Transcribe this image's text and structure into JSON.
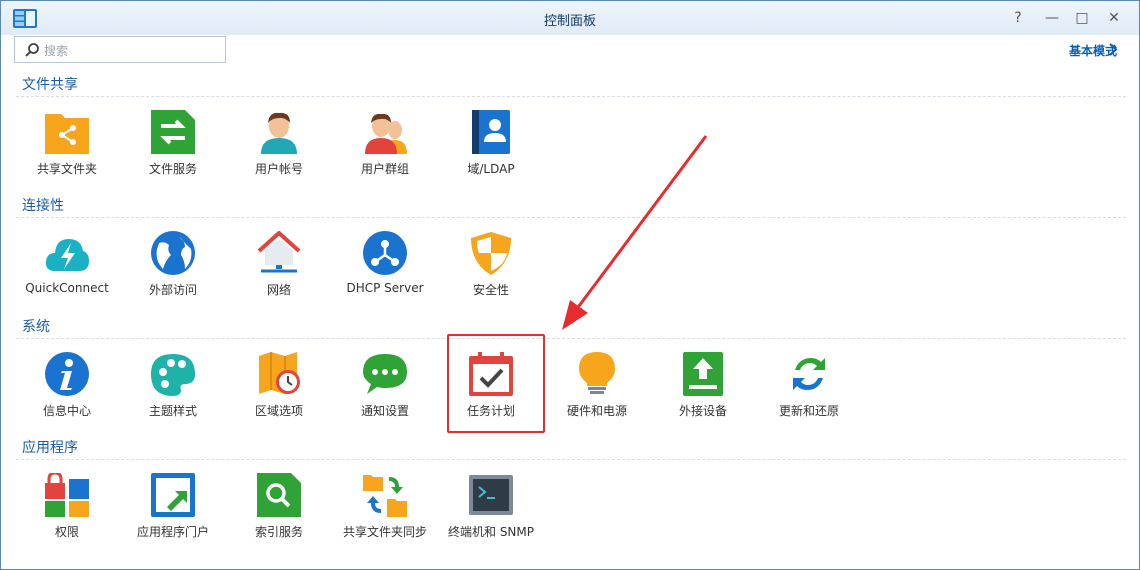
{
  "window": {
    "title": "控制面板"
  },
  "search": {
    "placeholder": "搜索"
  },
  "mode_switch": {
    "label": "基本模式"
  },
  "window_buttons": {
    "help": "?",
    "minimize": "—",
    "maximize": "□",
    "close": "✕"
  },
  "sections": [
    {
      "title": "文件共享",
      "items": [
        {
          "label": "共享文件夹",
          "icon": "shared-folder-icon"
        },
        {
          "label": "文件服务",
          "icon": "file-services-icon"
        },
        {
          "label": "用户帐号",
          "icon": "user-icon"
        },
        {
          "label": "用户群组",
          "icon": "group-icon"
        },
        {
          "label": "域/LDAP",
          "icon": "domain-ldap-icon"
        }
      ]
    },
    {
      "title": "连接性",
      "items": [
        {
          "label": "QuickConnect",
          "icon": "quickconnect-icon"
        },
        {
          "label": "外部访问",
          "icon": "external-access-icon"
        },
        {
          "label": "网络",
          "icon": "network-icon"
        },
        {
          "label": "DHCP Server",
          "icon": "dhcp-server-icon"
        },
        {
          "label": "安全性",
          "icon": "security-shield-icon"
        }
      ]
    },
    {
      "title": "系统",
      "items": [
        {
          "label": "信息中心",
          "icon": "info-center-icon"
        },
        {
          "label": "主题样式",
          "icon": "theme-palette-icon"
        },
        {
          "label": "区域选项",
          "icon": "regional-options-icon"
        },
        {
          "label": "通知设置",
          "icon": "notification-icon"
        },
        {
          "label": "任务计划",
          "icon": "task-scheduler-icon"
        },
        {
          "label": "硬件和电源",
          "icon": "hardware-power-icon"
        },
        {
          "label": "外接设备",
          "icon": "external-devices-icon"
        },
        {
          "label": "更新和还原",
          "icon": "update-restore-icon"
        }
      ]
    },
    {
      "title": "应用程序",
      "items": [
        {
          "label": "权限",
          "icon": "privileges-icon"
        },
        {
          "label": "应用程序门户",
          "icon": "application-portal-icon"
        },
        {
          "label": "索引服务",
          "icon": "indexing-service-icon"
        },
        {
          "label": "共享文件夹同步",
          "icon": "shared-folder-sync-icon"
        },
        {
          "label": "终端机和 SNMP",
          "icon": "terminal-snmp-icon"
        }
      ]
    }
  ],
  "colors": {
    "accent": "#1b5da8",
    "highlight": "#e62c2c"
  }
}
